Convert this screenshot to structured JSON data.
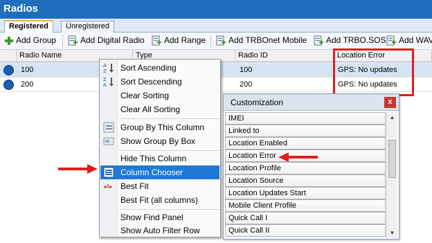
{
  "window": {
    "title": "Radios"
  },
  "tabs": [
    {
      "label": "Registered",
      "active": true
    },
    {
      "label": "Unregistered",
      "active": false
    }
  ],
  "toolbar": {
    "buttons": [
      {
        "label": "Add Group",
        "icon": "plus-icon"
      },
      {
        "label": "Add Digital Radio",
        "icon": "add-radio-icon"
      },
      {
        "label": "Add Range",
        "icon": "add-radio-icon"
      },
      {
        "label": "Add TRBOnet Mobile",
        "icon": "add-radio-icon"
      },
      {
        "label": "Add TRBO.SOS",
        "icon": "add-radio-icon"
      },
      {
        "label": "Add WAV",
        "icon": "add-radio-icon"
      }
    ]
  },
  "grid": {
    "columns": [
      "Radio Name",
      "Type",
      "Radio ID",
      "Location Error"
    ],
    "rows": [
      {
        "name": "100",
        "radio_id": "100",
        "location_error": "GPS: No updates"
      },
      {
        "name": "200",
        "radio_id": "200",
        "location_error": "GPS: No updates"
      }
    ]
  },
  "context_menu": {
    "groups": [
      [
        {
          "label": "Sort Ascending",
          "icon": "sort-ascending-icon"
        },
        {
          "label": "Sort Descending",
          "icon": "sort-descending-icon"
        },
        {
          "label": "Clear Sorting",
          "icon": ""
        },
        {
          "label": "Clear All Sorting",
          "icon": ""
        }
      ],
      [
        {
          "label": "Group By This Column",
          "icon": "group-by-icon"
        },
        {
          "label": "Show Group By Box",
          "icon": "group-box-icon"
        }
      ],
      [
        {
          "label": "Hide This Column",
          "icon": ""
        },
        {
          "label": "Column Chooser",
          "icon": "column-chooser-icon",
          "highlighted": true
        },
        {
          "label": "Best Fit",
          "icon": "best-fit-icon"
        },
        {
          "label": "Best Fit (all columns)",
          "icon": ""
        }
      ],
      [
        {
          "label": "Show Find Panel",
          "icon": ""
        },
        {
          "label": "Show Auto Filter Row",
          "icon": ""
        }
      ]
    ]
  },
  "customization": {
    "title": "Customization",
    "close_label": "x",
    "items": [
      "IMEI",
      "Linked to",
      "Location Enabled",
      "Location Error",
      "Location Profile",
      "Location Source",
      "Location Updates Start",
      "Mobile Client Profile",
      "Quick Call I",
      "Quick Call II"
    ]
  },
  "colors": {
    "title_bar": "#1f6dbb",
    "highlight": "#1e7ad6",
    "annotation_red": "#e41c1c"
  }
}
